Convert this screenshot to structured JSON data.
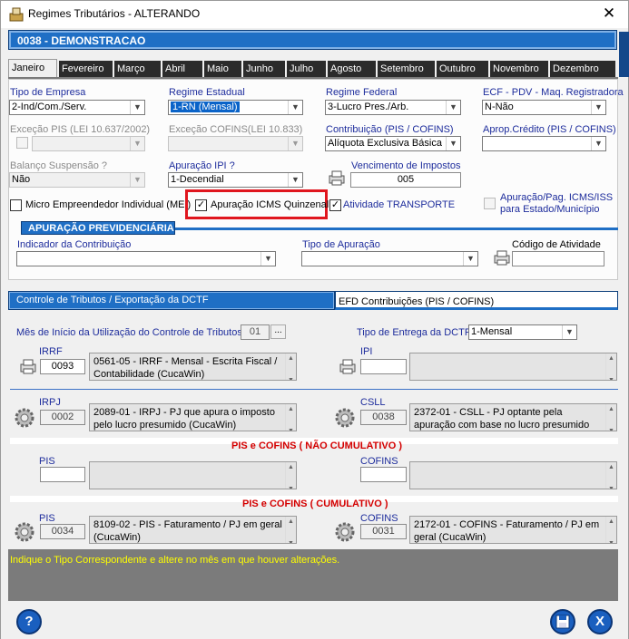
{
  "window": {
    "title": "Regimes Tributários   -   ALTERANDO",
    "close": "✕"
  },
  "company": "0038 - DEMONSTRACAO",
  "months": [
    "Janeiro",
    "Fevereiro",
    "Março",
    "Abril",
    "Maio",
    "Junho",
    "Julho",
    "Agosto",
    "Setembro",
    "Outubro",
    "Novembro",
    "Dezembro"
  ],
  "fields": {
    "tipo_empresa": {
      "label": "Tipo de Empresa",
      "value": "2-Ind/Com./Serv."
    },
    "regime_estadual": {
      "label": "Regime Estadual",
      "value": "1-RN (Mensal)"
    },
    "regime_federal": {
      "label": "Regime Federal",
      "value": "3-Lucro Pres./Arb."
    },
    "ecf": {
      "label": "ECF - PDV - Maq. Registradora",
      "value": "N-Não"
    },
    "excecao_pis": {
      "label": "Exceção PIS (LEI 10.637/2002)",
      "value": ""
    },
    "excecao_cofins": {
      "label": "Exceção COFINS(LEI 10.833)",
      "value": ""
    },
    "contribuicao": {
      "label": "Contribuição (PIS / COFINS)",
      "value": "Alíquota Exclusiva Básica"
    },
    "aprop_credito": {
      "label": "Aprop.Crédito (PIS / COFINS)",
      "value": ""
    },
    "balanco": {
      "label": "Balanço Suspensão ?",
      "value": "Não"
    },
    "apuracao_ipi": {
      "label": "Apuração IPI ?",
      "value": "1-Decendial"
    },
    "vencimento": {
      "label": "Vencimento de Impostos",
      "value": "005"
    }
  },
  "checks": {
    "mei": {
      "label": "Micro Empreendedor Individual (MEI)",
      "checked": false
    },
    "icms_quinzenal": {
      "label": "Apuração ICMS Quinzenal",
      "checked": true
    },
    "transporte": {
      "label": "Atividade TRANSPORTE",
      "checked": true
    },
    "apuracao_pag": {
      "label": "Apuração/Pag. ICMS/ISS para Estado/Município",
      "checked": false
    }
  },
  "previdenciaria": {
    "title": "APURAÇÃO PREVIDENCIÁRIA",
    "indicador_label": "Indicador da Contribuição",
    "tipo_apuracao_label": "Tipo de Apuração",
    "codigo_atividade_label": "Código de Atividade"
  },
  "subtabs": {
    "active": "Controle de Tributos / Exportação da DCTF",
    "other": "EFD Contribuições (PIS / COFINS)"
  },
  "dctf": {
    "mes_inicio_label": "Mês de Início da Utilização do Controle de Tributos:",
    "mes_inicio_value": "01",
    "browse": "...",
    "tipo_entrega_label": "Tipo de Entrega da DCTF:",
    "tipo_entrega_value": "1-Mensal"
  },
  "tributos": {
    "irrf": {
      "label": "IRRF",
      "code": "0093",
      "desc": "0561-05 - IRRF - Mensal - Escrita Fiscal / Contabilidade (CucaWin)"
    },
    "ipi": {
      "label": "IPI",
      "code": "",
      "desc": ""
    },
    "irpj": {
      "label": "IRPJ",
      "code": "0002",
      "desc": "2089-01 - IRPJ - PJ que apura o imposto pelo lucro presumido (CucaWin)"
    },
    "csll": {
      "label": "CSLL",
      "code": "0038",
      "desc": "2372-01 - CSLL - PJ optante pela apuração com base no lucro presumido"
    },
    "nc_header": "PIS e COFINS ( NÃO CUMULATIVO )",
    "pis_nc": {
      "label": "PIS",
      "code": "",
      "desc": ""
    },
    "cofins_nc": {
      "label": "COFINS",
      "code": "",
      "desc": ""
    },
    "c_header": "PIS e COFINS ( CUMULATIVO )",
    "pis_c": {
      "label": "PIS",
      "code": "0034",
      "desc": "8109-02 - PIS - Faturamento / PJ em geral (CucaWin)"
    },
    "cofins_c": {
      "label": "COFINS",
      "code": "0031",
      "desc": "2172-01 - COFINS - Faturamento / PJ em geral (CucaWin)"
    }
  },
  "status_message": "Indique o Tipo Correspondente e altere no mês em que houver alterações.",
  "buttons": {
    "help": "?",
    "save": "💾",
    "exit": "X"
  }
}
